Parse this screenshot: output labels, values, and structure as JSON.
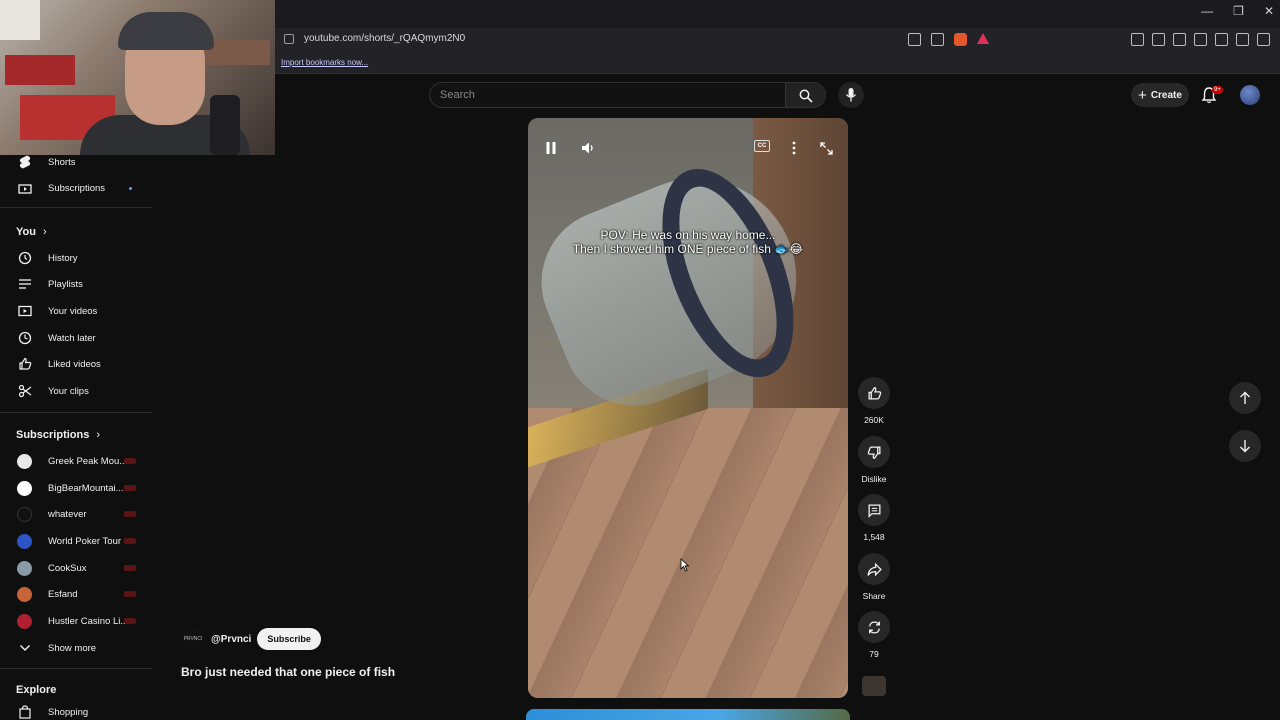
{
  "browser": {
    "url": "youtube.com/shorts/_rQAQmym2N0",
    "bookmarks_link": "Import bookmarks now...",
    "window_controls": [
      "minimize",
      "restore",
      "close"
    ]
  },
  "header": {
    "search_placeholder": "Search",
    "create_label": "Create",
    "notifications_badge": "9+"
  },
  "sidebar": {
    "shorts": "Shorts",
    "subscriptions": "Subscriptions",
    "you_heading": "You",
    "you_items": [
      {
        "label": "History",
        "icon": "history-icon"
      },
      {
        "label": "Playlists",
        "icon": "playlists-icon"
      },
      {
        "label": "Your videos",
        "icon": "your-videos-icon"
      },
      {
        "label": "Watch later",
        "icon": "watch-later-icon"
      },
      {
        "label": "Liked videos",
        "icon": "like-icon"
      },
      {
        "label": "Your clips",
        "icon": "scissors-icon"
      }
    ],
    "subscriptions_heading": "Subscriptions",
    "channels": [
      {
        "label": "Greek Peak Mou...",
        "color": "#e8e8e8"
      },
      {
        "label": "BigBearMountai...",
        "color": "#ffffff"
      },
      {
        "label": "whatever",
        "color": "#111111"
      },
      {
        "label": "World Poker Tour",
        "color": "#2d55c8"
      },
      {
        "label": "CookSux",
        "color": "#8a9aa6"
      },
      {
        "label": "Esfand",
        "color": "#c8643a"
      },
      {
        "label": "Hustler Casino Li...",
        "color": "#b02030"
      }
    ],
    "show_more": "Show more",
    "explore_heading": "Explore",
    "shopping": "Shopping"
  },
  "video": {
    "caption_line1": "POV: He was on his way home...",
    "caption_line2": "Then I showed him ONE piece of fish 🐟😂"
  },
  "actions": {
    "likes": "260K",
    "dislike": "Dislike",
    "comments": "1,548",
    "share": "Share",
    "remix": "79"
  },
  "channel": {
    "logo_text": "PRVNCI",
    "handle": "@Prvnci",
    "subscribe": "Subscribe"
  },
  "title": "Bro just needed that one piece of fish"
}
